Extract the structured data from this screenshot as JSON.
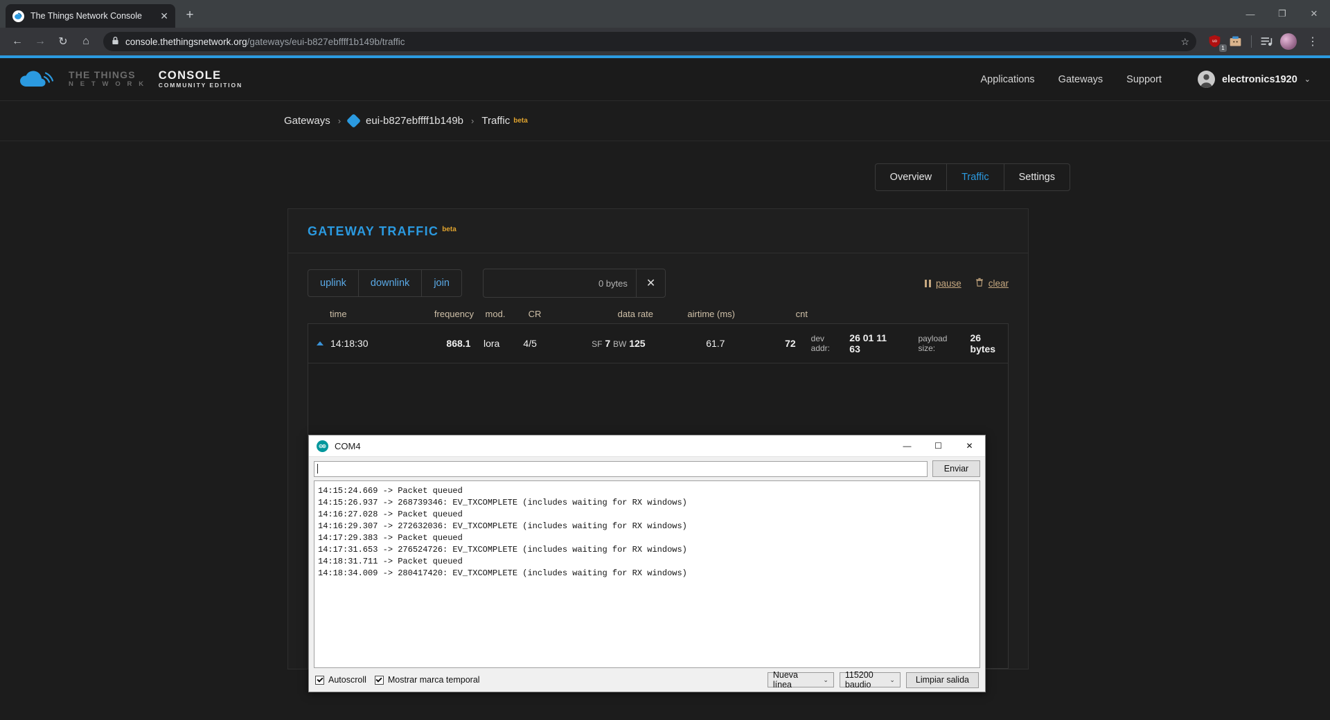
{
  "browser": {
    "tab_title": "The Things Network Console",
    "tab_close": "✕",
    "new_tab": "+",
    "window": {
      "minimize": "—",
      "restore": "❐",
      "close": "✕"
    },
    "nav": {
      "back": "←",
      "forward": "→",
      "reload": "↻",
      "home": "⌂"
    },
    "url_secure": "console.thethingsnetwork.org",
    "url_path": "/gateways/eui-b827ebffff1b149b/traffic",
    "star": "☆",
    "extension_badge": "1",
    "kebab": "⋮"
  },
  "ttn_header": {
    "brand_line1": "THE THINGS",
    "brand_line2": "N E T W O R K",
    "console_line1": "CONSOLE",
    "console_line2": "COMMUNITY EDITION",
    "nav": [
      "Applications",
      "Gateways",
      "Support"
    ],
    "username": "electronics1920",
    "caret": "⌄"
  },
  "breadcrumb": {
    "root": "Gateways",
    "sep": "›",
    "gateway_id": "eui-b827ebffff1b149b",
    "current": "Traffic",
    "beta": "beta"
  },
  "tabs": [
    {
      "label": "Overview",
      "active": false
    },
    {
      "label": "Traffic",
      "active": true
    },
    {
      "label": "Settings",
      "active": false
    }
  ],
  "panel": {
    "title": "GATEWAY TRAFFIC",
    "beta": "beta",
    "filters": [
      "uplink",
      "downlink",
      "join"
    ],
    "search_value": "0 bytes",
    "search_clear": "✕",
    "pause_label": "pause",
    "clear_label": "clear",
    "columns": {
      "time": "time",
      "frequency": "frequency",
      "mod": "mod.",
      "cr": "CR",
      "data_rate": "data rate",
      "airtime": "airtime (ms)",
      "cnt": "cnt"
    },
    "rows": [
      {
        "time": "14:18:30",
        "frequency": "868.1",
        "mod": "lora",
        "cr": "4/5",
        "dr_sf_label": "SF",
        "dr_sf_value": "7",
        "dr_bw_label": "BW",
        "dr_bw_value": "125",
        "airtime": "61.7",
        "cnt": "72",
        "devaddr_label": "dev addr:",
        "devaddr_value": "26 01 11 63",
        "payload_label": "payload size:",
        "payload_value": "26 bytes"
      }
    ]
  },
  "serial": {
    "title": "COM4",
    "minimize": "—",
    "maximize": "☐",
    "close": "✕",
    "input_value": "",
    "send_label": "Enviar",
    "log": "14:15:24.669 -> Packet queued\n14:15:26.937 -> 268739346: EV_TXCOMPLETE (includes waiting for RX windows)\n14:16:27.028 -> Packet queued\n14:16:29.307 -> 272632036: EV_TXCOMPLETE (includes waiting for RX windows)\n14:17:29.383 -> Packet queued\n14:17:31.653 -> 276524726: EV_TXCOMPLETE (includes waiting for RX windows)\n14:18:31.711 -> Packet queued\n14:18:34.009 -> 280417420: EV_TXCOMPLETE (includes waiting for RX windows)",
    "autoscroll_label": "Autoscroll",
    "timestamp_label": "Mostrar marca temporal",
    "line_ending": "Nueva línea",
    "baud_rate": "115200 baudio",
    "clear_output": "Limpiar salida",
    "sel_caret": "⌄"
  },
  "colors": {
    "ttn_blue": "#2b9ae0",
    "beta_amber": "#e0a32e",
    "link_tan": "#c6a880",
    "arduino_teal": "#00979c"
  }
}
